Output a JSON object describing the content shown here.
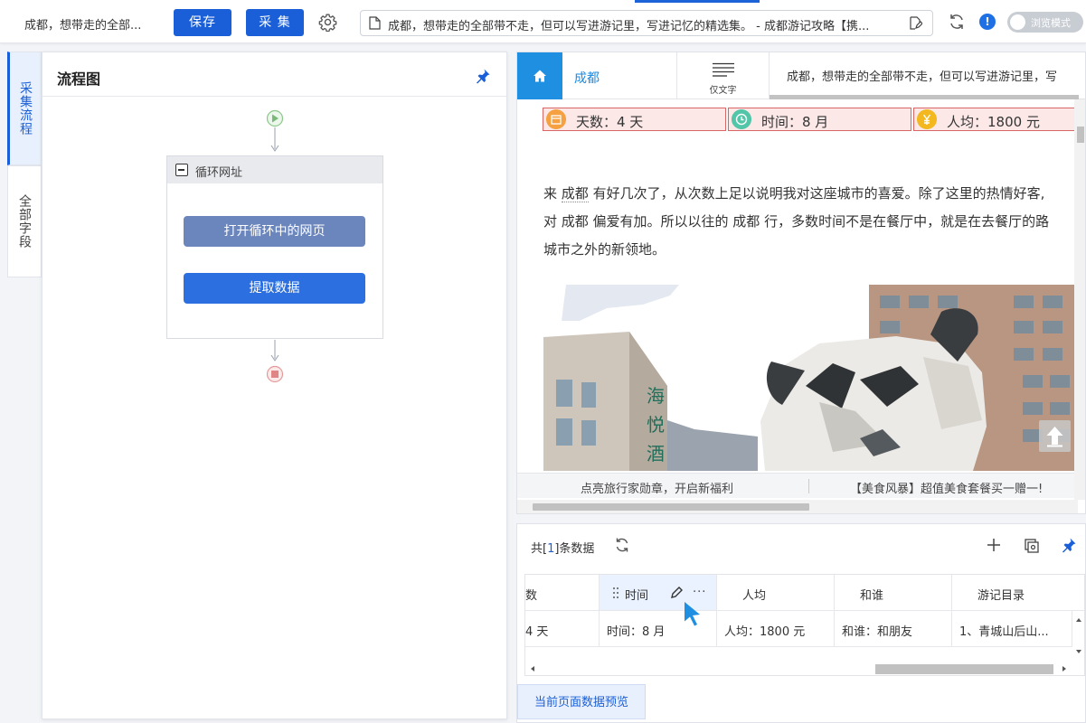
{
  "topbar": {
    "task_name": "成都，想带走的全部...",
    "save_label": "保存",
    "collect_label": "采 集",
    "url_text": "成都，想带走的全部带不走，但可以写进游记里，写进记忆的精选集。 - 成都游记攻略【携...",
    "info_badge": "!",
    "browse_mode_label": "浏览模式"
  },
  "sidebar": {
    "tabs": [
      {
        "label": "采集流程",
        "active": true
      },
      {
        "label": "全部字段",
        "active": false
      }
    ]
  },
  "flow": {
    "title": "流程图",
    "loop_label": "循环网址",
    "nodes": [
      {
        "label": "打开循环中的网页"
      },
      {
        "label": "提取数据"
      }
    ]
  },
  "browser": {
    "tabs": {
      "city": "成都",
      "text_only": "仅文字",
      "article": "成都，想带走的全部带不走，但可以写进游记里，写"
    },
    "badges": [
      {
        "text": "天数：4 天",
        "icon": "calendar-icon",
        "color": "#f5a142"
      },
      {
        "text": "时间：8 月",
        "icon": "clock-icon",
        "color": "#53c5a8"
      },
      {
        "text": "人均：1800 元",
        "icon": "yen-icon",
        "color": "#f3b81f"
      }
    ],
    "paragraph": {
      "line1_a": "来 ",
      "line1_link": "成都",
      "line1_b": " 有好几次了，从次数上足以说明我对这座城市的喜爱。除了这里的热情好客,",
      "line2": "对 成都 偏爱有加。所以以往的 成都 行，多数时间不是在餐厅中，就是在去餐厅的路",
      "line3": "城市之外的新领地。"
    },
    "promo": {
      "left": "点亮旅行家勋章，开启新福利",
      "right": "【美食风暴】超值美食套餐买一赠一!"
    }
  },
  "data_panel": {
    "count_prefix": "共[",
    "count_value": "1",
    "count_suffix": "]条数据",
    "columns": [
      "数",
      "时间",
      "人均",
      "和谁",
      "游记目录"
    ],
    "more": "···",
    "rows": [
      [
        "4 天",
        "时间：8 月",
        "人均：1800 元",
        "和谁：和朋友",
        "1、青城山后山..."
      ]
    ],
    "preview_tab": "当前页面数据预览"
  },
  "colors": {
    "primary": "#1a5fd8",
    "accent_blue": "#1e8fe1",
    "badge_bg": "#fde8e8",
    "badge_border": "#d96565"
  }
}
